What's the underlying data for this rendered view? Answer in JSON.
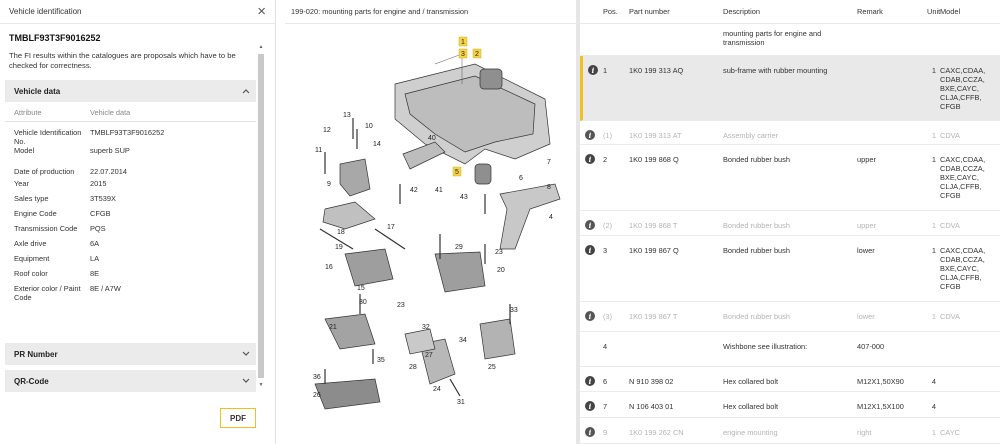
{
  "vehicle_panel": {
    "title": "Vehicle identification",
    "close_icon": "×",
    "vin": "TMBLF93T3F9016252",
    "note": "The FI results within the catalogues are proposals which have to be checked for correctness.",
    "vehicle_data": {
      "heading": "Vehicle data",
      "attr_header": "Attribute",
      "value_header": "Vehicle data",
      "rows": [
        {
          "attr": "Vehicle Identification No.",
          "value": "TMBLF93T3F9016252"
        },
        {
          "attr": "Model",
          "value": "superb SUP"
        },
        {
          "attr": "Date of production",
          "value": "22.07.2014"
        },
        {
          "attr": "Year",
          "value": "2015"
        },
        {
          "attr": "Sales type",
          "value": "3T539X"
        },
        {
          "attr": "Engine Code",
          "value": "CFGB"
        },
        {
          "attr": "Transmission Code",
          "value": "PQS"
        },
        {
          "attr": "Axle drive",
          "value": "6A"
        },
        {
          "attr": "Equipment",
          "value": "LA"
        },
        {
          "attr": "Roof color",
          "value": "8E"
        },
        {
          "attr": "Exterior color / Paint Code",
          "value": "8E / A7W"
        }
      ]
    },
    "pr_number": "PR Number",
    "qr_code": "QR-Code",
    "pdf_label": "PDF"
  },
  "diagram": {
    "title": "199-020: mounting parts for engine and / transmission",
    "callouts": [
      "1",
      "2",
      "3",
      "4",
      "5",
      "6",
      "7",
      "8",
      "9",
      "10",
      "11",
      "12",
      "13",
      "14",
      "15",
      "16",
      "17",
      "18",
      "19",
      "20",
      "21",
      "22",
      "23",
      "24",
      "25",
      "26",
      "27",
      "28",
      "29",
      "30",
      "31",
      "32",
      "33",
      "34",
      "35",
      "36",
      "38",
      "40",
      "41",
      "42",
      "43"
    ],
    "highlighted": [
      "1",
      "2",
      "3",
      "5"
    ]
  },
  "parts_table": {
    "headers": {
      "pos": "Pos.",
      "part_number": "Part number",
      "description": "Description",
      "remark": "Remark",
      "unit": "Unit",
      "model": "Model"
    },
    "rows": [
      {
        "info": false,
        "dim": false,
        "selected": false,
        "pos": "",
        "part_number": "",
        "description": "mounting parts for engine and transmission",
        "remark": "",
        "unit": "",
        "model": ""
      },
      {
        "info": true,
        "dim": false,
        "selected": true,
        "pos": "1",
        "part_number": "1K0 199 313 AQ",
        "description": "sub-frame with rubber mounting",
        "remark": "",
        "unit": "1",
        "model": "CAXC,CDAA, CDAB,CCZA, BXE,CAYC, CLJA,CFFB, CFGB"
      },
      {
        "info": true,
        "dim": true,
        "selected": false,
        "pos": "(1)",
        "part_number": "1K0 199 313 AT",
        "description": "Assembly carrier",
        "remark": "",
        "unit": "1",
        "model": "CDVA"
      },
      {
        "info": true,
        "dim": false,
        "selected": false,
        "pos": "2",
        "part_number": "1K0 199 868 Q",
        "description": "Bonded rubber bush",
        "remark": "upper",
        "unit": "1",
        "model": "CAXC,CDAA, CDAB,CCZA, BXE,CAYC, CLJA,CFFB, CFGB"
      },
      {
        "info": true,
        "dim": true,
        "selected": false,
        "pos": "(2)",
        "part_number": "1K0 199 868 T",
        "description": "Bonded rubber bush",
        "remark": "upper",
        "unit": "1",
        "model": "CDVA"
      },
      {
        "info": true,
        "dim": false,
        "selected": false,
        "pos": "3",
        "part_number": "1K0 199 867 Q",
        "description": "Bonded rubber bush",
        "remark": "lower",
        "unit": "1",
        "model": "CAXC,CDAA, CDAB,CCZA, BXE,CAYC, CLJA,CFFB, CFGB"
      },
      {
        "info": true,
        "dim": true,
        "selected": false,
        "pos": "(3)",
        "part_number": "1K0 199 867 T",
        "description": "Bonded rubber bush",
        "remark": "lower",
        "unit": "1",
        "model": "CDVA"
      },
      {
        "info": false,
        "dim": false,
        "selected": false,
        "pos": "4",
        "part_number": "",
        "description": "Wishbone see illustration:",
        "remark": "407-000",
        "unit": "",
        "model": ""
      },
      {
        "info": true,
        "dim": false,
        "selected": false,
        "pos": "6",
        "part_number": "N  910 398 02",
        "description": "Hex collared bolt",
        "remark": "M12X1,50X90",
        "unit": "4",
        "model": ""
      },
      {
        "info": true,
        "dim": false,
        "selected": false,
        "pos": "7",
        "part_number": "N  106 403 01",
        "description": "Hex collared bolt",
        "remark": "M12X1,5X100",
        "unit": "4",
        "model": ""
      },
      {
        "info": true,
        "dim": true,
        "selected": false,
        "pos": "9",
        "part_number": "1K0 199 262 CN",
        "description": "engine mounting",
        "remark": "right",
        "unit": "1",
        "model": "CAYC"
      }
    ]
  },
  "colors": {
    "accent": "#f0c11a",
    "section_bg": "#ebebeb",
    "selected_bg": "#e9e9e9",
    "dim_text": "#b4b4b4"
  }
}
